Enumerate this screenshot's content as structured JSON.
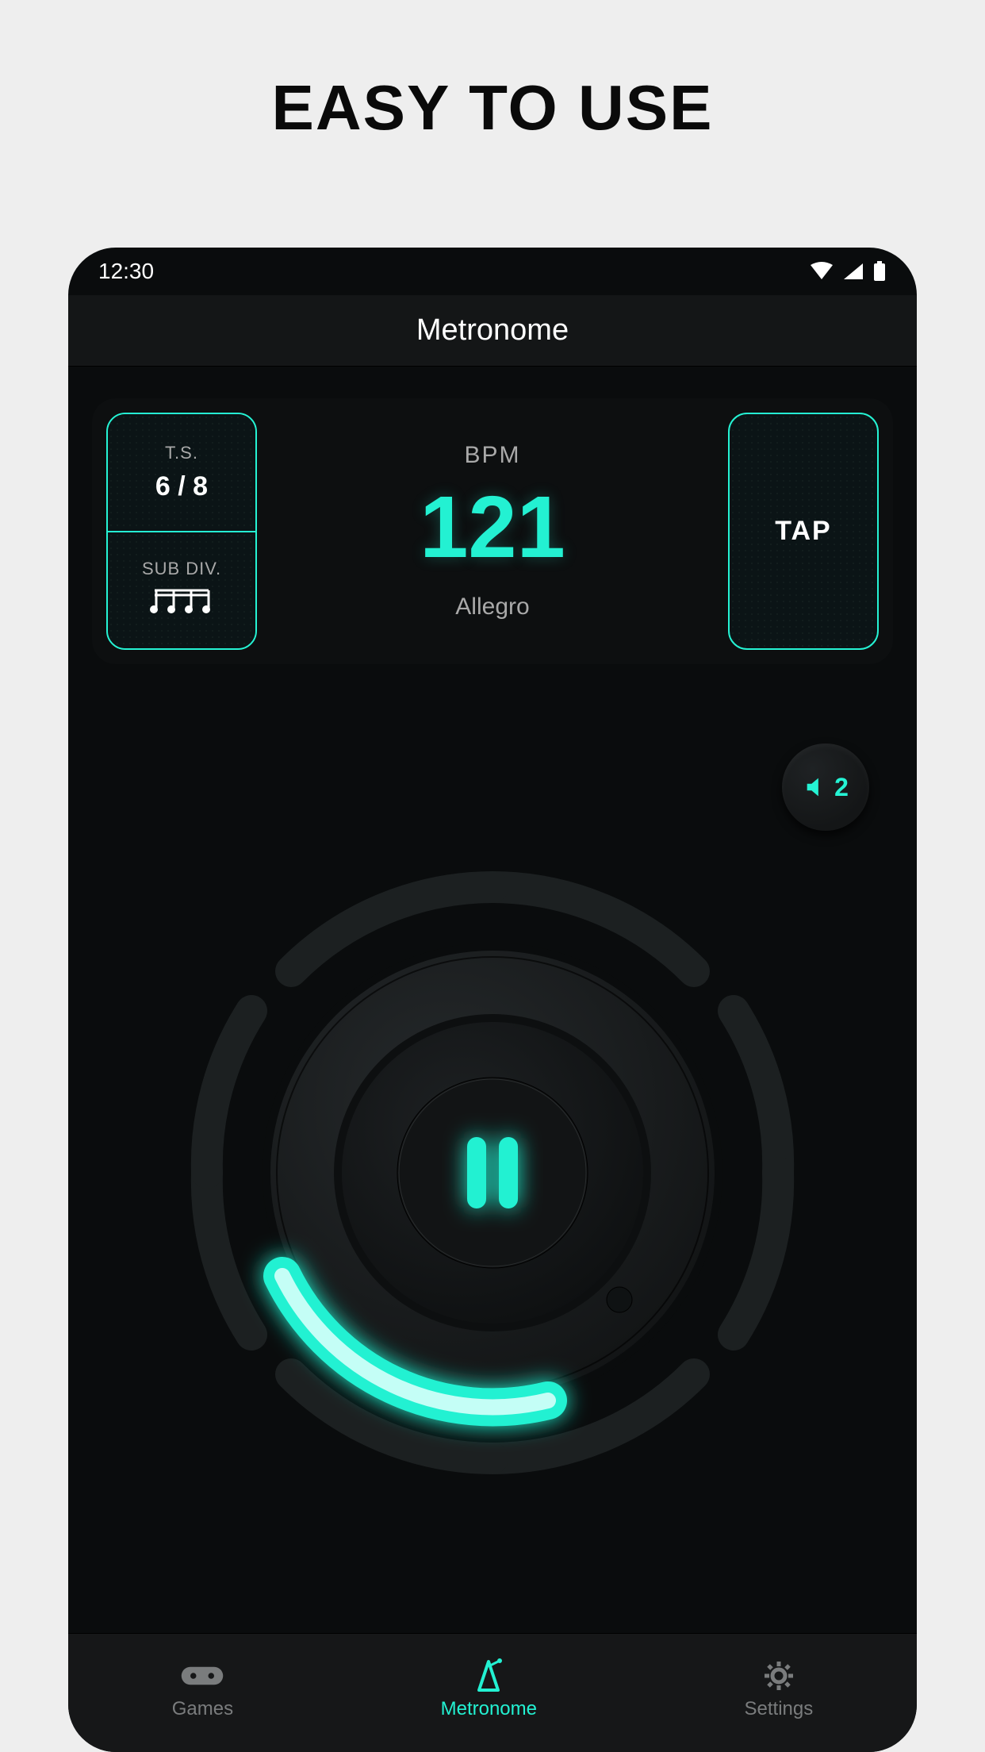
{
  "promo": {
    "title": "EASY TO USE"
  },
  "status": {
    "time": "12:30"
  },
  "header": {
    "title": "Metronome"
  },
  "card": {
    "ts_label": "T.S.",
    "ts_value": "6 / 8",
    "subdiv_label": "SUB DIV.",
    "subdiv_icon": "sixteenth-notes",
    "bpm_label": "BPM",
    "bpm_value": "121",
    "tempo_name": "Allegro",
    "tap_label": "TAP"
  },
  "sound": {
    "value": "2"
  },
  "nav": {
    "games": "Games",
    "metronome": "Metronome",
    "settings": "Settings"
  },
  "colors": {
    "accent": "#23f1d2"
  }
}
